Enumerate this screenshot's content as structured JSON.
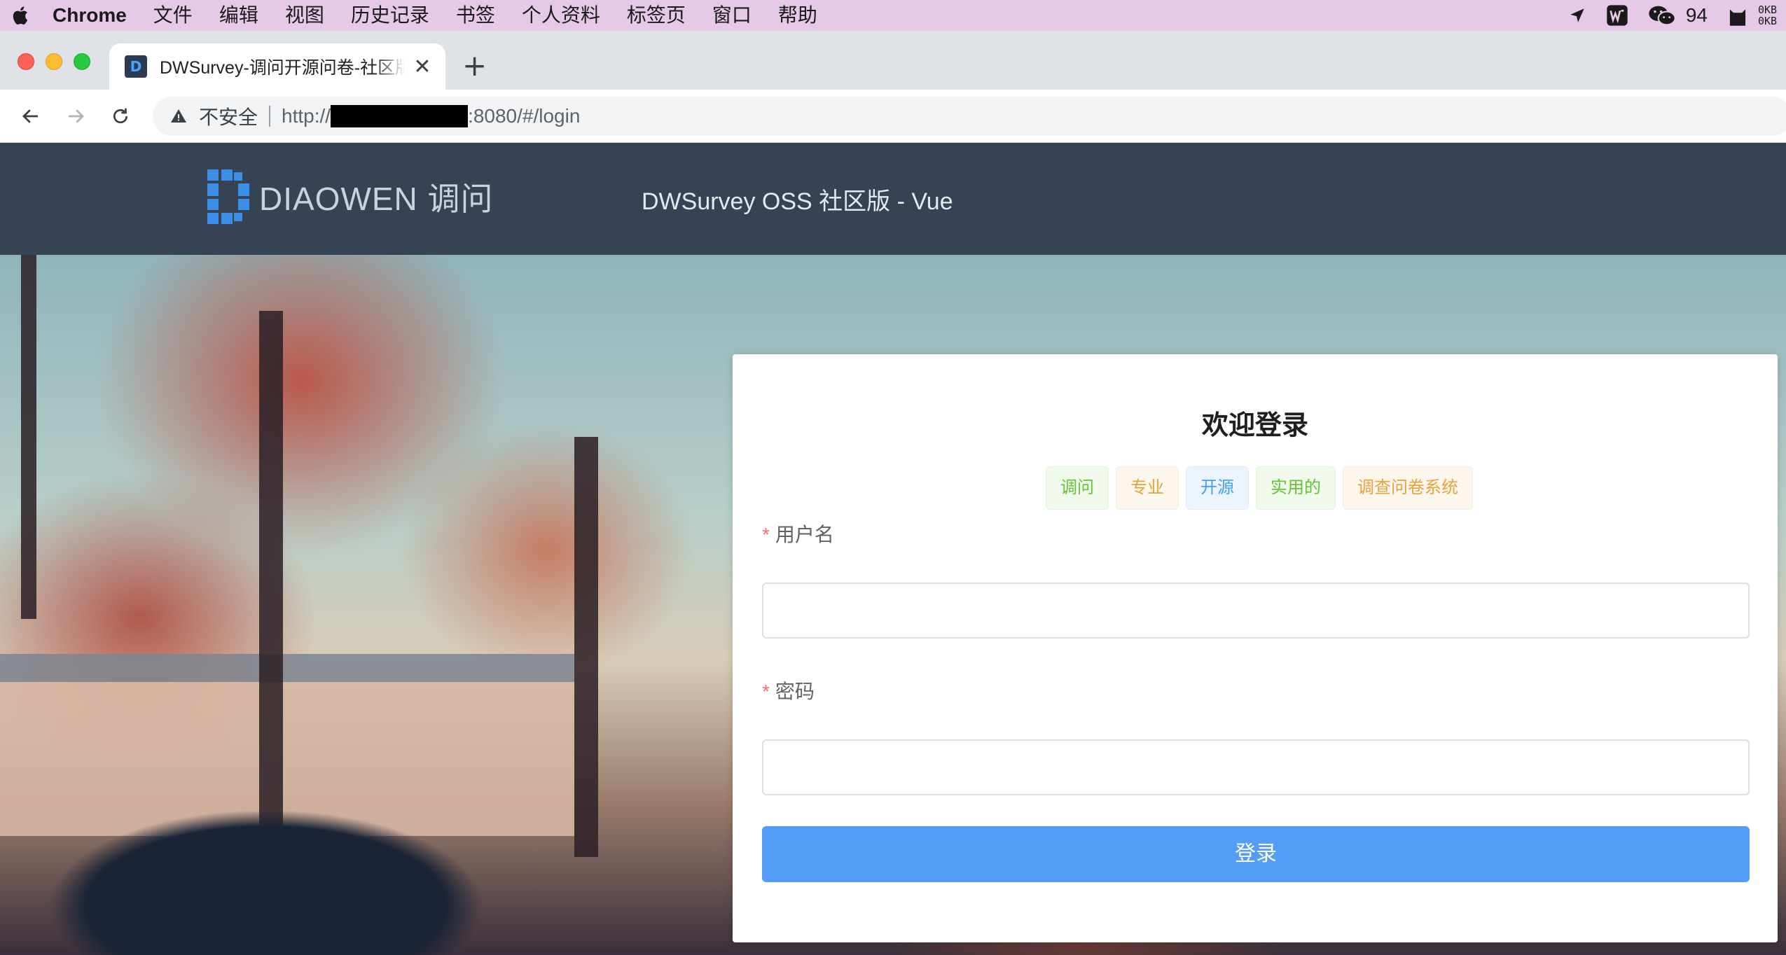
{
  "menubar": {
    "items": [
      "Chrome",
      "文件",
      "编辑",
      "视图",
      "历史记录",
      "书签",
      "个人资料",
      "标签页",
      "窗口",
      "帮助"
    ],
    "tray_count": "94",
    "net_up": "0KB",
    "net_down": "0KB",
    "icons": [
      "apple-icon",
      "location-arrow-icon",
      "wps-icon",
      "wechat-icon",
      "cat-icon"
    ]
  },
  "browser": {
    "tab_title": "DWSurvey-调问开源问卷-社区版",
    "tab_close": "✕",
    "new_tab": "+",
    "security_label": "不安全",
    "url_prefix": "http://",
    "url_suffix": ":8080/#/login"
  },
  "site": {
    "logo_text": "DIAOWEN 调问",
    "header_title": "DWSurvey OSS 社区版 - Vue"
  },
  "login": {
    "heading": "欢迎登录",
    "tags": [
      {
        "label": "调问",
        "type": "success"
      },
      {
        "label": "专业",
        "type": "warning"
      },
      {
        "label": "开源",
        "type": "primary"
      },
      {
        "label": "实用的",
        "type": "success"
      },
      {
        "label": "调查问卷系统",
        "type": "warning"
      }
    ],
    "required_mark": "*",
    "username_label": "用户名",
    "username_value": "",
    "password_label": "密码",
    "password_value": "",
    "submit_label": "登录"
  },
  "colors": {
    "header_bg": "#364354",
    "primary_button": "#539df9",
    "required": "#f56c6c",
    "menubar_bg": "#e6c9e6"
  }
}
